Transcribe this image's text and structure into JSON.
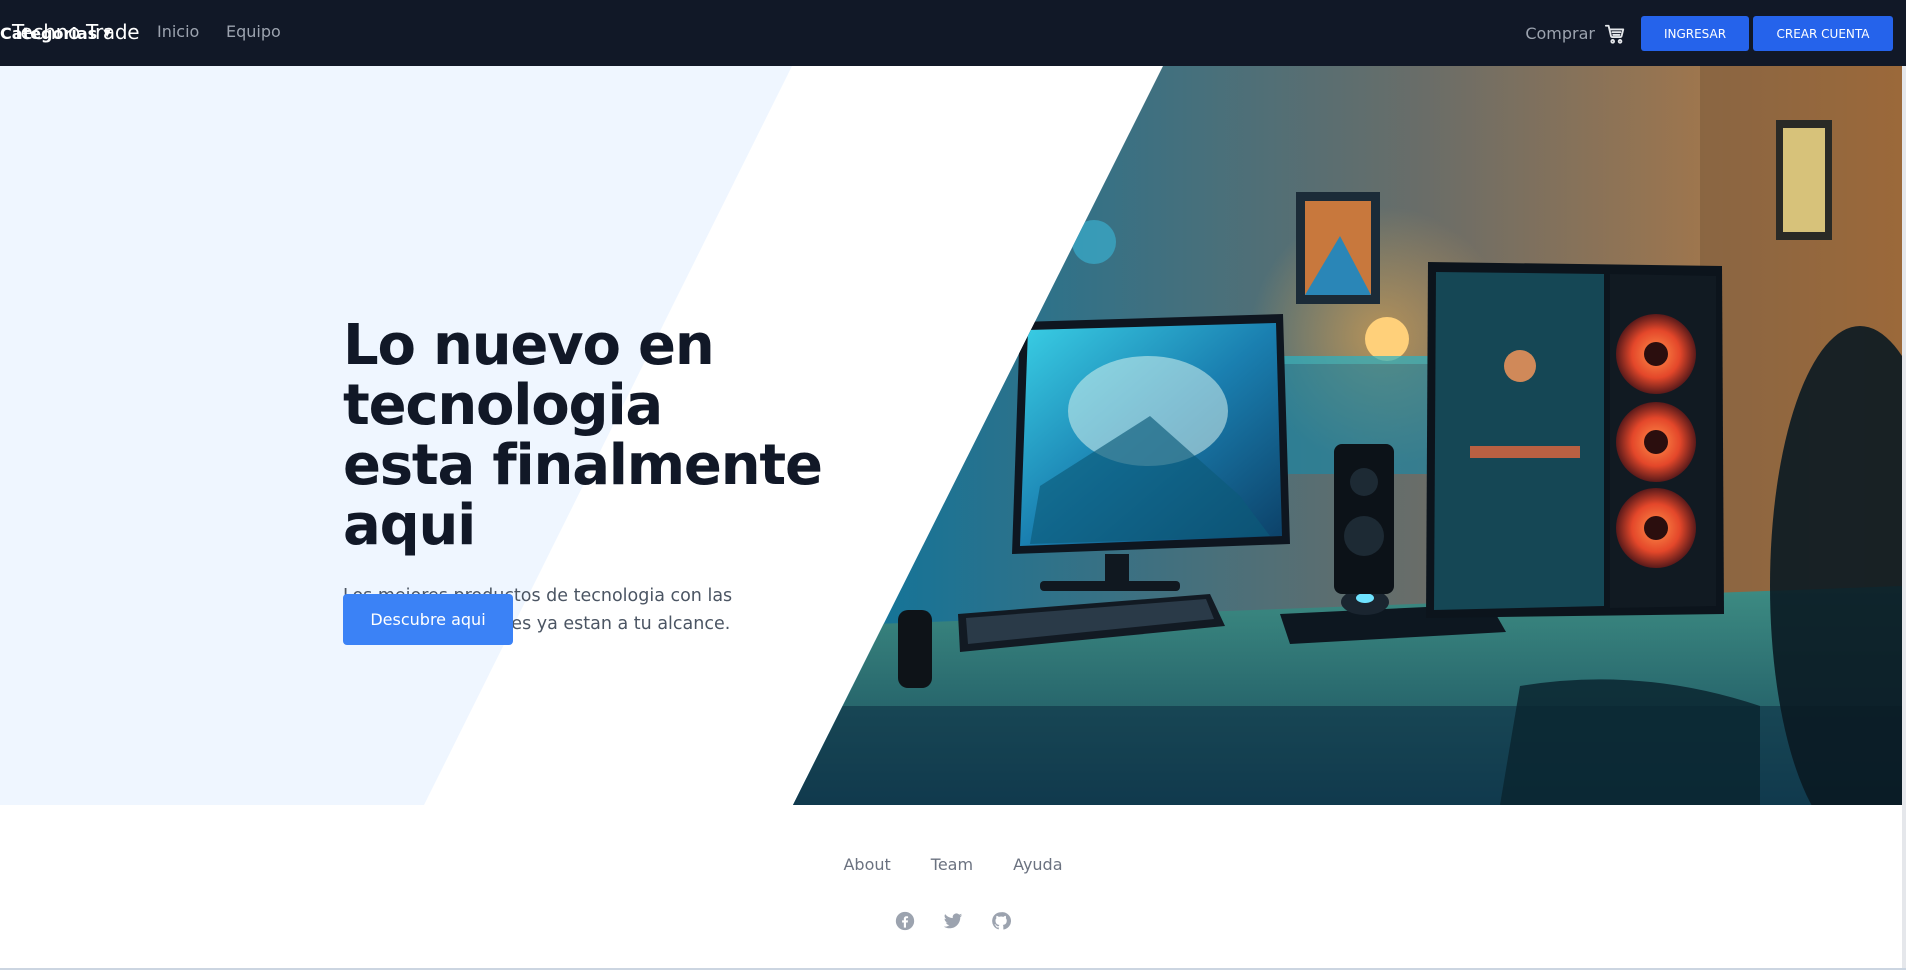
{
  "navbar": {
    "brand": "Techno Trade",
    "links": [
      "Inicio",
      "Equipo"
    ],
    "categories_label": "Categorias",
    "categories_caret": "▼",
    "shop_label": "Comprar",
    "cart_icon": "cart-icon",
    "login_label": "INGRESAR",
    "signup_label": "CREAR CUENTA"
  },
  "hero": {
    "title_lines": [
      "Lo nuevo en",
      "tecnologia",
      "esta finalmente",
      "aqui"
    ],
    "subtitle": "Los mejores productos de tecnologia con las mejores promociones ya estan a tu alcance.",
    "cta_label": "Descubre aqui"
  },
  "footer": {
    "links": [
      "About",
      "Team",
      "Ayuda"
    ],
    "social_icons": [
      "facebook-icon",
      "twitter-icon",
      "github-icon"
    ]
  },
  "colors": {
    "navbar_bg": "#111827",
    "accent": "#2563eb",
    "cta": "#3b82f6",
    "hero_tint": "#eff6ff"
  }
}
